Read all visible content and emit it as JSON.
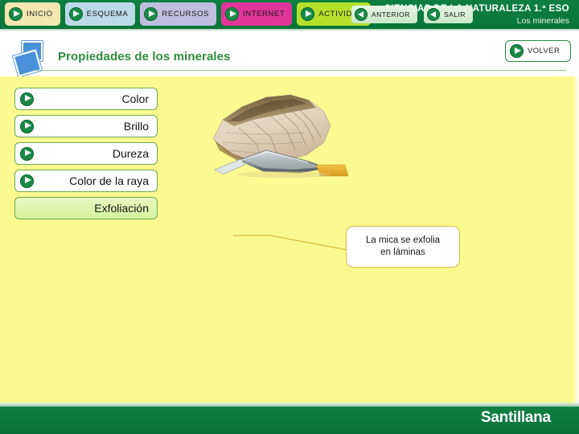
{
  "header": {
    "title": "CIENCIAS DE LA NATURALEZA 1.ª ESO",
    "subtitle": "Los minerales",
    "bar_color": "#0a7a3c",
    "tabs": [
      {
        "label": "INICIO",
        "icon": "play-circle-icon",
        "color": "#f3e6b0"
      },
      {
        "label": "ESQUEMA",
        "icon": "play-circle-icon",
        "color": "#bcd9e8"
      },
      {
        "label": "RECURSOS",
        "icon": "play-circle-icon",
        "color": "#bfbede"
      },
      {
        "label": "INTERNET",
        "icon": "play-circle-icon",
        "color": "#e0359a"
      },
      {
        "label": "ACTIVIDAD",
        "icon": "play-circle-icon",
        "color": "#b5e02a"
      }
    ]
  },
  "subheader": {
    "icon": "slides-document-icon",
    "title": "Propiedades de los minerales",
    "title_color": "#2b8c3d",
    "volver": {
      "label": "VOLVER",
      "icon": "play-circle-icon"
    }
  },
  "content": {
    "background_color": "#fbfa91",
    "menu": [
      {
        "label": "Color",
        "icon": "play-circle-icon",
        "active": false
      },
      {
        "label": "Brillo",
        "icon": "play-circle-icon",
        "active": false
      },
      {
        "label": "Dureza",
        "icon": "play-circle-icon",
        "active": false
      },
      {
        "label": "Color de la raya",
        "icon": "play-circle-icon",
        "active": false
      },
      {
        "label": "Exfoliación",
        "icon": null,
        "active": true
      }
    ],
    "photo": {
      "alt": "Muestra de mica exfoliándose en láminas con una navaja",
      "accent_color": "#d8b840"
    },
    "callout": {
      "line1": "La mica se exfolia",
      "line2": "en láminas",
      "border_color": "#d8b840"
    }
  },
  "footer": {
    "background_color": "#0d7a3c",
    "buttons": [
      {
        "label": "ANTERIOR",
        "icon": "play-circle-back-icon"
      },
      {
        "label": "SALIR",
        "icon": "play-circle-back-icon"
      }
    ],
    "brand": "Santillana"
  }
}
